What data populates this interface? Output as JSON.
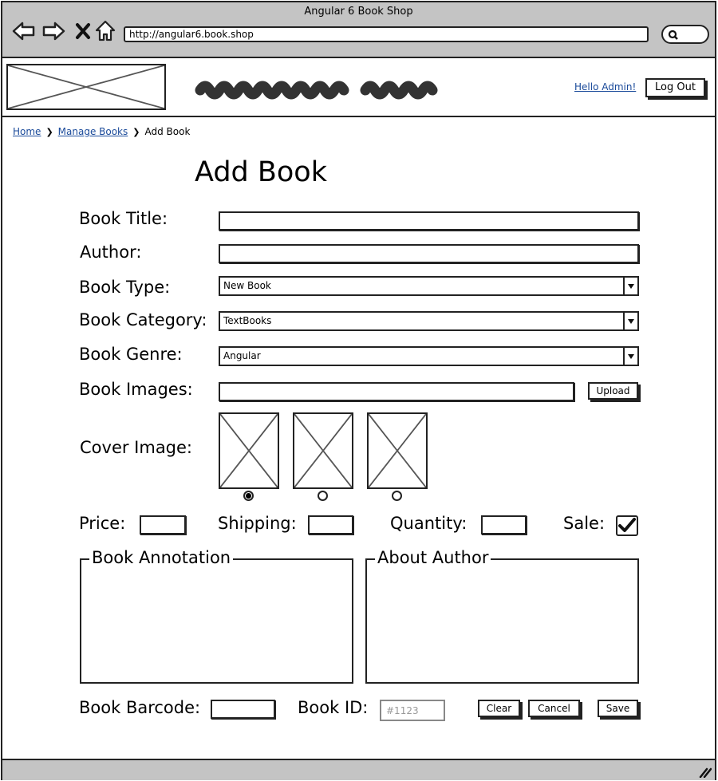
{
  "window": {
    "title": "Angular 6 Book Shop"
  },
  "browser": {
    "url": "http://angular6.book.shop"
  },
  "header": {
    "hello_link": "Hello Admin!",
    "logout_label": "Log Out"
  },
  "breadcrumb": {
    "items": [
      "Home",
      "Manage Books",
      "Add Book"
    ]
  },
  "page": {
    "title": "Add Book"
  },
  "form": {
    "book_title": {
      "label": "Book Title:",
      "value": ""
    },
    "author": {
      "label": "Author:",
      "value": ""
    },
    "book_type": {
      "label": "Book Type:",
      "selected": "New Book"
    },
    "book_category": {
      "label": "Book Category:",
      "selected": "TextBooks"
    },
    "book_genre": {
      "label": "Book Genre:",
      "selected": "Angular"
    },
    "book_images": {
      "label": "Book Images:",
      "value": "",
      "upload_label": "Upload"
    },
    "cover_image": {
      "label": "Cover Image:",
      "selected_index": 0
    },
    "price": {
      "label": "Price:",
      "value": ""
    },
    "shipping": {
      "label": "Shipping:",
      "value": ""
    },
    "quantity": {
      "label": "Quantity:",
      "value": ""
    },
    "sale": {
      "label": "Sale:",
      "checked": true
    },
    "annotation": {
      "legend": "Book Annotation"
    },
    "about_author": {
      "legend": "About Author"
    },
    "barcode": {
      "label": "Book Barcode:",
      "value": ""
    },
    "book_id": {
      "label": "Book ID:",
      "placeholder": "#1123"
    },
    "buttons": {
      "clear": "Clear",
      "cancel": "Cancel",
      "save": "Save"
    }
  }
}
